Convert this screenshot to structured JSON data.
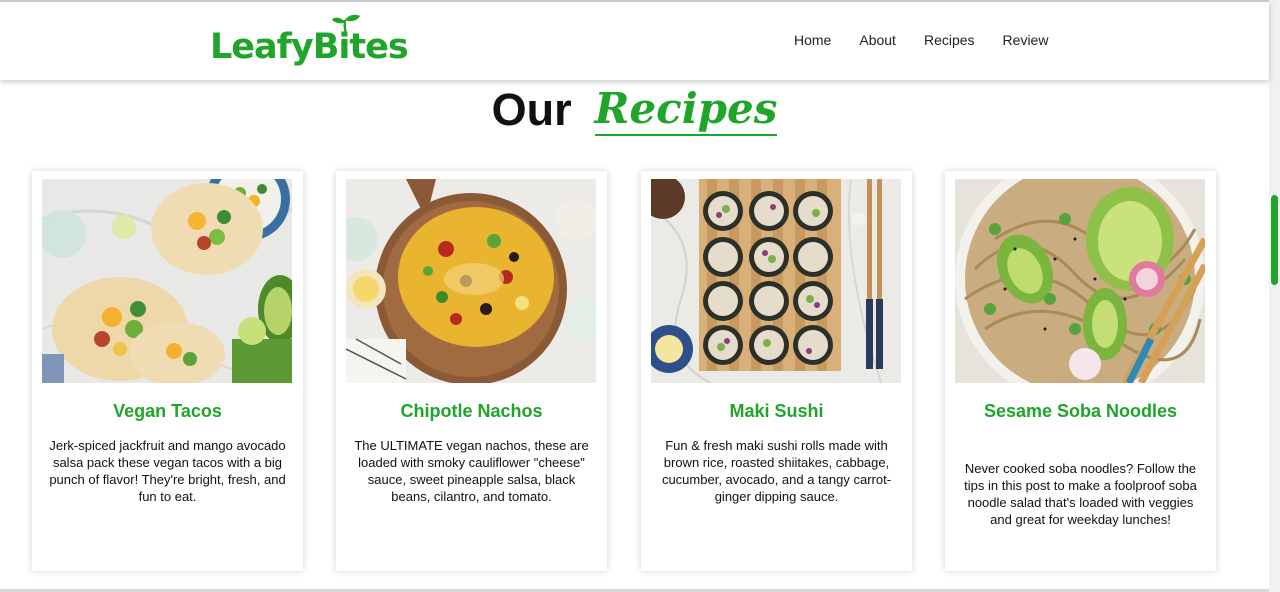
{
  "colors": {
    "accent": "#1fa52a"
  },
  "header": {
    "logo_text": "LeafyBites",
    "nav": [
      {
        "label": "Home"
      },
      {
        "label": "About"
      },
      {
        "label": "Recipes"
      },
      {
        "label": "Review"
      }
    ]
  },
  "section": {
    "title_plain": "Our",
    "title_accent": "Recipes"
  },
  "recipes": [
    {
      "title": "Vegan Tacos",
      "description": "Jerk-spiced jackfruit and mango avocado salsa pack these vegan tacos with a big punch of flavor! They're bright, fresh, and fun to eat."
    },
    {
      "title": "Chipotle Nachos",
      "description": "The ULTIMATE vegan nachos, these are loaded with smoky cauliflower \"cheese\" sauce, sweet pineapple salsa, black beans, cilantro, and tomato."
    },
    {
      "title": "Maki Sushi",
      "description": "Fun & fresh maki sushi rolls made with brown rice, roasted shiitakes, cabbage, cucumber, avocado, and a tangy carrot-ginger dipping sauce."
    },
    {
      "title": "Sesame Soba Noodles",
      "description": "Never cooked soba noodles? Follow the tips in this post to make a foolproof soba noodle salad that's loaded with veggies and great for weekday lunches!"
    }
  ]
}
